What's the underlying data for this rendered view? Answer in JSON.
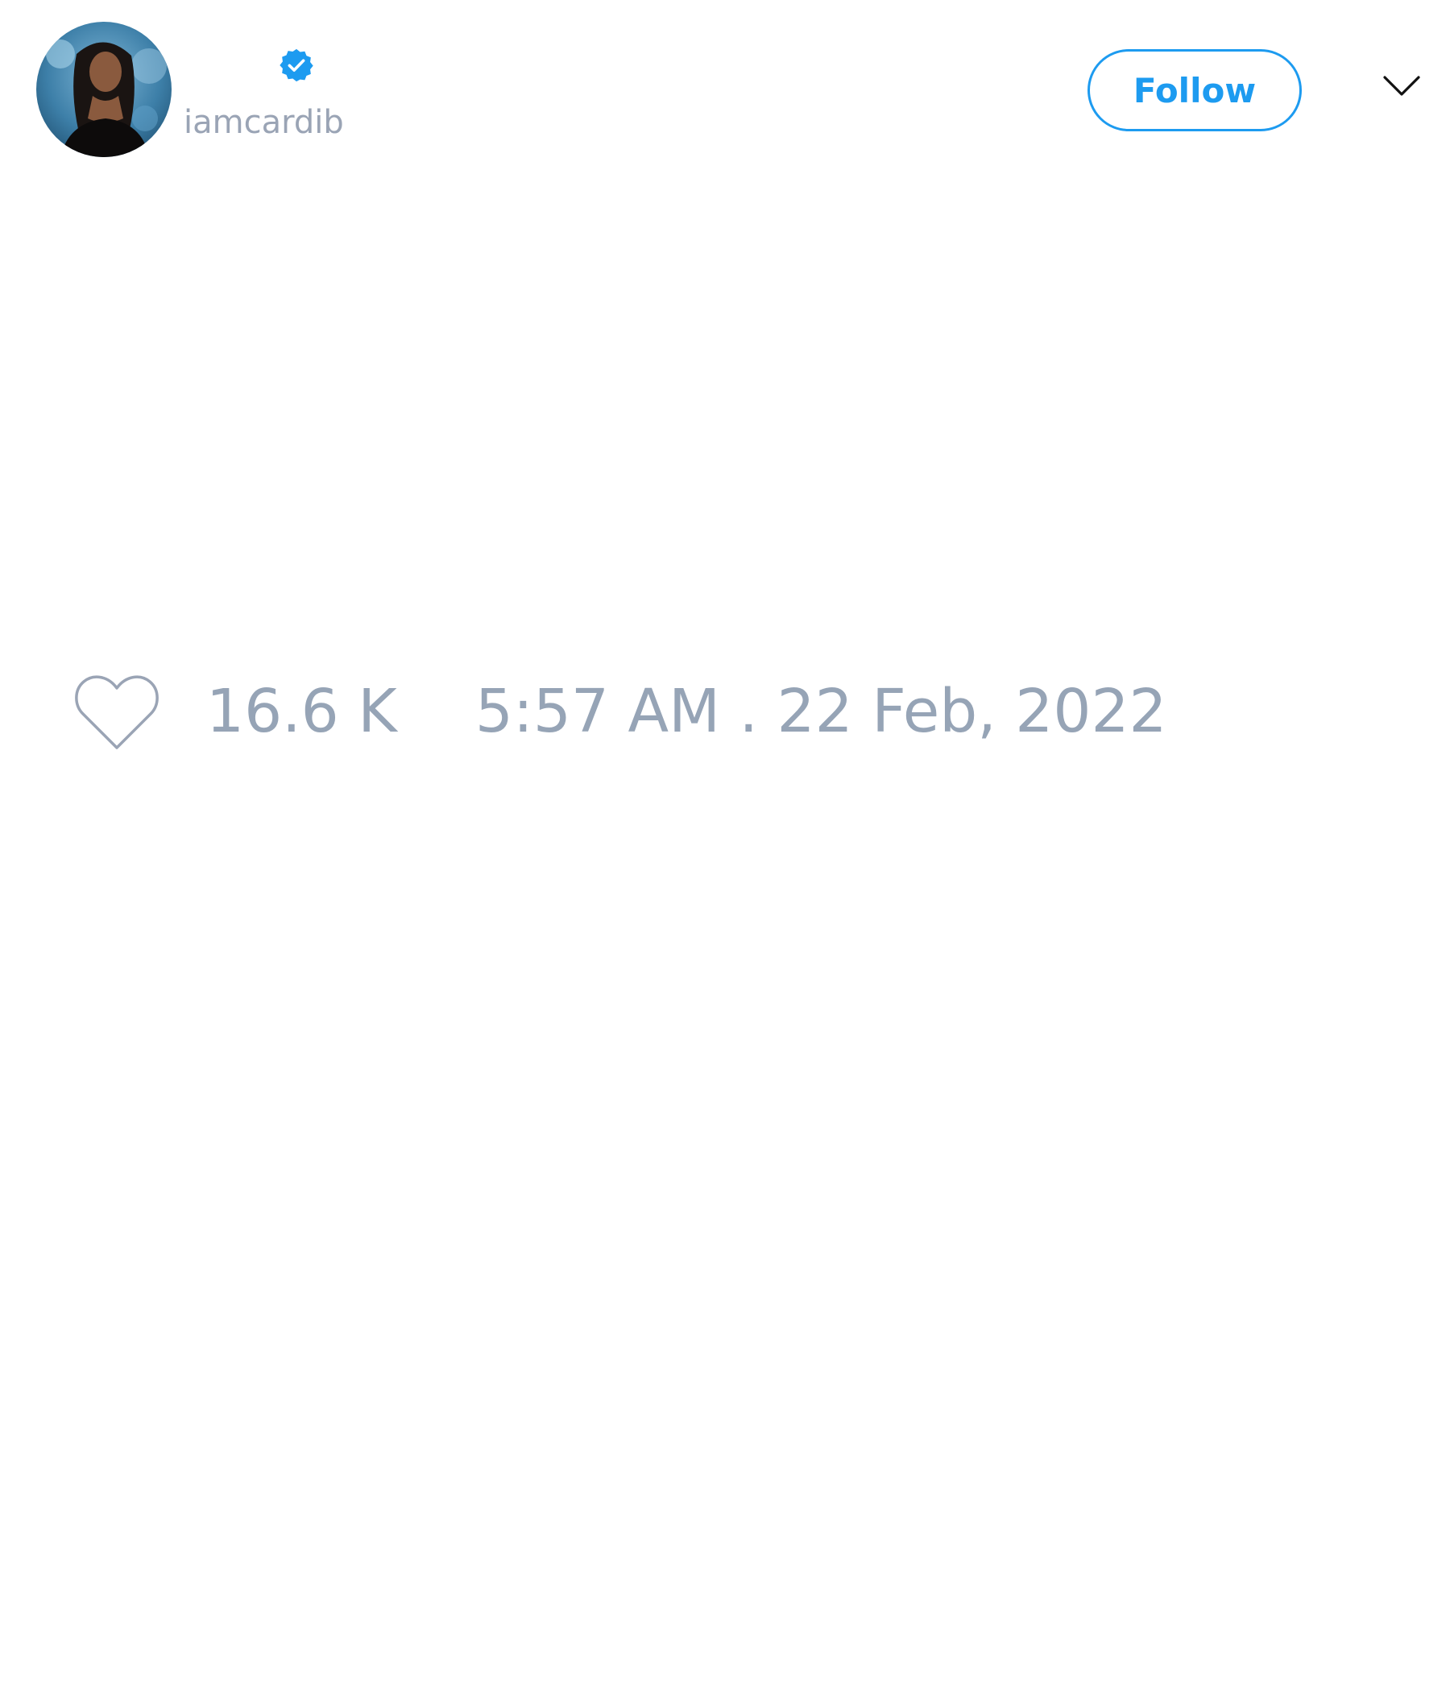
{
  "user": {
    "handle": "iamcardib",
    "verified": true
  },
  "header": {
    "follow_label": "Follow",
    "menu_icon": "chevron-down-icon"
  },
  "stats": {
    "likes": "16.6 K",
    "timestamp": "5:57 AM . 22 Feb, 2022"
  },
  "colors": {
    "accent": "#1d9bf0",
    "muted_text": "#96a4b6",
    "icon_gray": "#9aa4b5",
    "background": "#ffffff"
  }
}
